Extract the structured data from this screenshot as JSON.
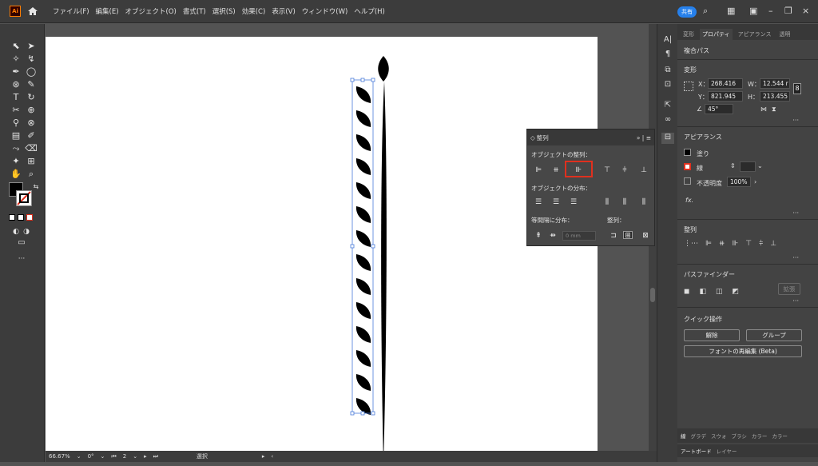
{
  "app": {
    "logo": "Ai",
    "share_label": "共有",
    "menu": [
      "ファイル(F)",
      "編集(E)",
      "オブジェクト(O)",
      "書式(T)",
      "選択(S)",
      "効果(C)",
      "表示(V)",
      "ウィンドウ(W)",
      "ヘルプ(H)"
    ]
  },
  "statusbar": {
    "zoom": "66.67%",
    "rotation": "0°",
    "artboard_number": "2",
    "tool": "選択"
  },
  "right_panel": {
    "tabs": [
      "変形",
      "プロパティ",
      "アピアランス",
      "透明"
    ],
    "active_tab": "プロパティ",
    "object_type": "複合パス",
    "transform": {
      "title": "変形",
      "x_label": "X：",
      "x_value": "268.416",
      "y_label": "Y：",
      "y_value": "821.945",
      "w_label": "W：",
      "w_value": "12.544 r",
      "h_label": "H：",
      "h_value": "213.455",
      "angle_value": "45°"
    },
    "appearance": {
      "title": "アピアランス",
      "fill_label": "塗り",
      "stroke_label": "線",
      "opacity_label": "不透明度",
      "opacity_value": "100%",
      "fx_label": "fx."
    },
    "align": {
      "title": "整列"
    },
    "pathfinder": {
      "title": "パスファインダー",
      "expand_label": "拡張"
    },
    "quick_actions": {
      "title": "クイック操作",
      "release_label": "解除",
      "group_label": "グループ",
      "reedit_font_label": "フォントの再編集 (Beta)"
    },
    "bottom_tabs": [
      "線",
      "グラデ",
      "スウォ",
      "ブラシ",
      "カラー",
      "カラー"
    ],
    "bottom_tabs2": [
      "アートボード",
      "レイヤー"
    ]
  },
  "align_panel": {
    "title": "整列",
    "align_objects_label": "オブジェクトの整列：",
    "distribute_objects_label": "オブジェクトの分布：",
    "distribute_spacing_label": "等間隔に分布：",
    "align_to_label": "整列：",
    "spacing_value": "0 mm"
  },
  "colors": {
    "accent": "#2680eb",
    "highlight": "#e0301e",
    "logo_orange": "#ff7c00"
  }
}
